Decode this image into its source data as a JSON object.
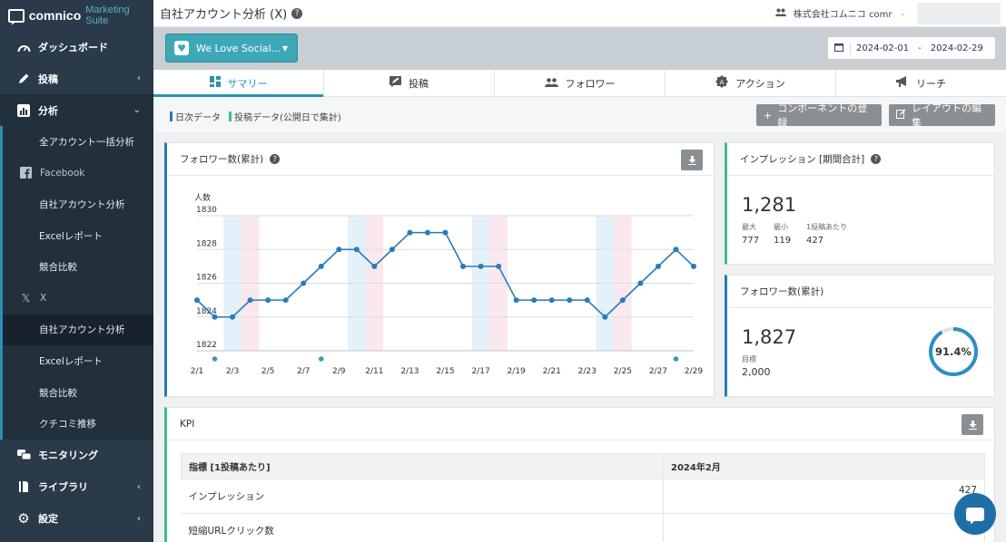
{
  "brand": {
    "name": "comnico",
    "suite": "Marketing Suite"
  },
  "sidebar": {
    "items": [
      {
        "label": "ダッシュボード",
        "icon": "speedometer-icon"
      },
      {
        "label": "投稿",
        "icon": "pencil-icon"
      },
      {
        "label": "分析",
        "icon": "bar-chart-icon"
      }
    ],
    "analysis_sub": [
      {
        "label": "全アカウント一括分析"
      },
      {
        "label": "Facebook",
        "section": true,
        "icon": "facebook-icon"
      },
      {
        "label": "自社アカウント分析"
      },
      {
        "label": "Excelレポート"
      },
      {
        "label": "競合比較"
      },
      {
        "label": "X",
        "section": true,
        "icon": "x-icon"
      },
      {
        "label": "自社アカウント分析",
        "current": true
      },
      {
        "label": "Excelレポート"
      },
      {
        "label": "競合比較"
      },
      {
        "label": "クチコミ推移"
      }
    ],
    "bottom_items": [
      {
        "label": "モニタリング",
        "icon": "monitoring-icon"
      },
      {
        "label": "ライブラリ",
        "icon": "library-icon"
      },
      {
        "label": "設定",
        "icon": "gear-icon"
      }
    ]
  },
  "topbar": {
    "title": "自社アカウント分析 (X)",
    "company": "株式会社コムニコ comr"
  },
  "account_selector": {
    "label": "We Love Social..."
  },
  "date_range": {
    "start": "2024-02-01",
    "separator": "-",
    "end": "2024-02-29"
  },
  "tabs": [
    {
      "label": "サマリー",
      "icon": "grid-icon",
      "active": true
    },
    {
      "label": "投稿",
      "icon": "compose-icon"
    },
    {
      "label": "フォロワー",
      "icon": "people-icon"
    },
    {
      "label": "アクション",
      "icon": "badge-icon"
    },
    {
      "label": "リーチ",
      "icon": "megaphone-icon"
    }
  ],
  "legend": {
    "daily": "日次データ",
    "post": "投稿データ(公開日で集計)"
  },
  "buttons": {
    "add_component": "コンポーネントの登録",
    "edit_layout": "レイアウトの編集"
  },
  "follower_chart": {
    "title": "フォロワー数(累計)",
    "chart_data": {
      "type": "line",
      "ylabel": "人数",
      "ylim": [
        1822,
        1830
      ],
      "yticks": [
        1822,
        1824,
        1826,
        1828,
        1830
      ],
      "xticks": [
        "2/1",
        "2/3",
        "2/5",
        "2/7",
        "2/9",
        "2/11",
        "2/13",
        "2/15",
        "2/17",
        "2/19",
        "2/21",
        "2/23",
        "2/25",
        "2/27",
        "2/29"
      ],
      "x": [
        "2/1",
        "2/2",
        "2/3",
        "2/4",
        "2/5",
        "2/6",
        "2/7",
        "2/8",
        "2/9",
        "2/10",
        "2/11",
        "2/12",
        "2/13",
        "2/14",
        "2/15",
        "2/16",
        "2/17",
        "2/18",
        "2/19",
        "2/20",
        "2/21",
        "2/22",
        "2/23",
        "2/24",
        "2/25",
        "2/26",
        "2/27",
        "2/28",
        "2/29"
      ],
      "values": [
        1825,
        1824,
        1824,
        1825,
        1825,
        1825,
        1826,
        1827,
        1828,
        1828,
        1827,
        1828,
        1829,
        1829,
        1829,
        1827,
        1827,
        1827,
        1825,
        1825,
        1825,
        1825,
        1825,
        1824,
        1825,
        1826,
        1827,
        1828,
        1827
      ],
      "post_markers": [
        "2/2",
        "2/8",
        "2/28"
      ],
      "weekend_days": [
        "2/3",
        "2/4",
        "2/10",
        "2/11",
        "2/17",
        "2/18",
        "2/24",
        "2/25"
      ],
      "colors": {
        "line": "#2a7bb8",
        "saturday": "#e4f1fa",
        "sunday": "#fbe7ee",
        "marker": "#3b9bb0"
      }
    }
  },
  "impressions": {
    "title": "インプレッション [期間合計]",
    "total": "1,281",
    "stats": [
      {
        "label": "最大",
        "value": "777"
      },
      {
        "label": "最小",
        "value": "119"
      },
      {
        "label": "1投稿あたり",
        "value": "427"
      }
    ]
  },
  "followers_panel": {
    "title": "フォロワー数(累計)",
    "count": "1,827",
    "goal_label": "目標",
    "goal_value": "2,000",
    "progress_label": "91.4%",
    "progress": 0.914
  },
  "kpi": {
    "title": "KPI",
    "columns": [
      "指標 [1投稿あたり]",
      "2024年2月"
    ],
    "rows": [
      {
        "metric": "インプレッション",
        "value": "427"
      },
      {
        "metric": "短縮URLクリック数",
        "value": ""
      }
    ]
  }
}
